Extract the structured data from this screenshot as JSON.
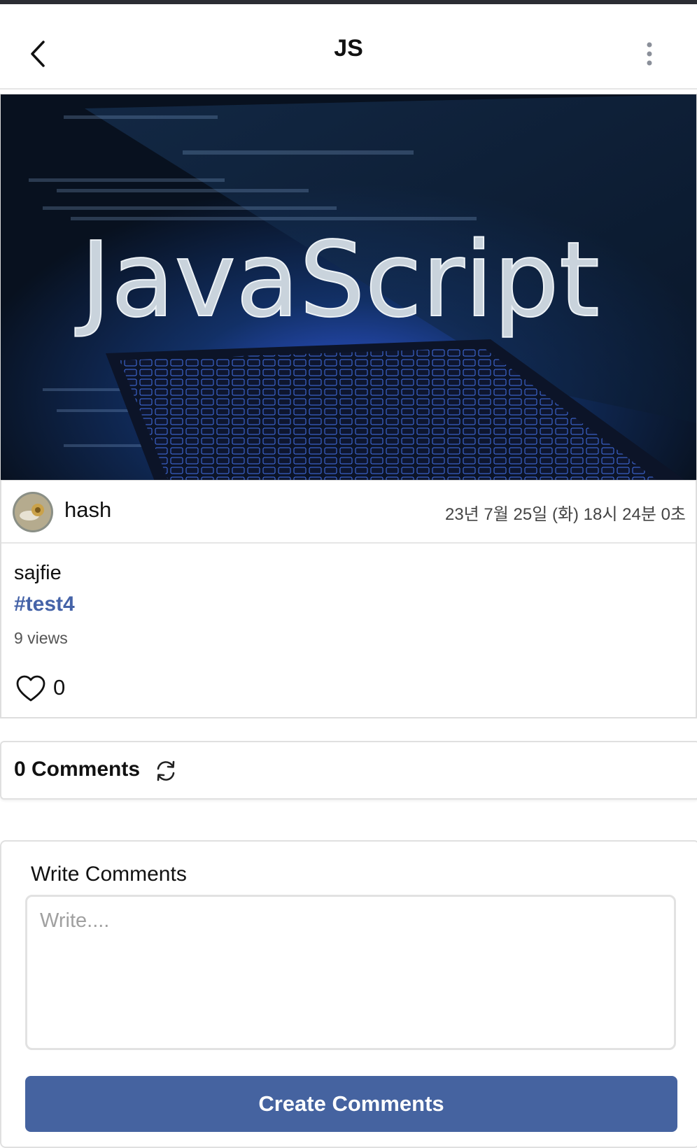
{
  "header": {
    "title": "JS",
    "back_icon": "chevron-left-icon",
    "more_icon": "vertical-dots-icon"
  },
  "hero": {
    "text": "JavaScript"
  },
  "post": {
    "author": "hash",
    "date": "23년 7월 25일 (화) 18시 24분 0초",
    "body": "sajfie",
    "hashtag": "#test4",
    "views": "9 views",
    "like_icon": "heart-icon",
    "like_count": "0"
  },
  "comments": {
    "title": "0 Comments",
    "refresh_icon": "refresh-icon"
  },
  "write": {
    "label": "Write Comments",
    "placeholder": "Write....",
    "value": "",
    "submit_label": "Create Comments"
  },
  "colors": {
    "accent": "#4563a0",
    "hashtag": "#4563a8",
    "hero_background": "#0d1e33"
  }
}
